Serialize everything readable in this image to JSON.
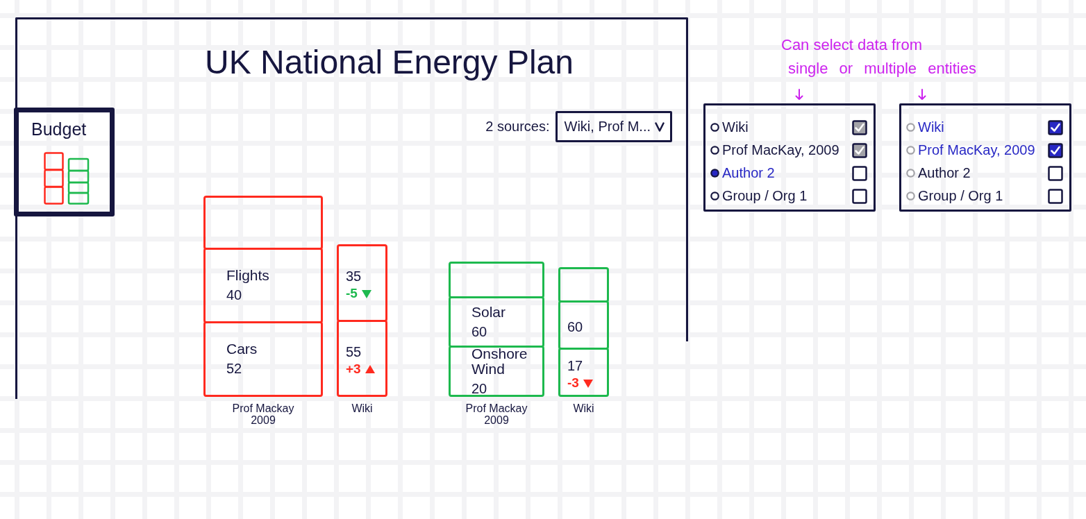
{
  "title": "UK National Energy Plan",
  "budget": {
    "title": "Budget"
  },
  "source_filter": {
    "label": "2 sources:",
    "value": "Wiki, Prof M..."
  },
  "stack_groups": [
    {
      "color": "#ff2a1f",
      "stacks": [
        {
          "caption": "Prof Mackay 2009",
          "segments": [
            {
              "kind": "empty"
            },
            {
              "kind": "item",
              "label": "Flights",
              "value": "40"
            },
            {
              "kind": "item",
              "label": "Cars",
              "value": "52"
            }
          ]
        },
        {
          "caption": "Wiki",
          "segments": [
            {
              "kind": "item",
              "value": "35",
              "change": {
                "text": "-5",
                "rising": false,
                "color": "#1db94e"
              }
            },
            {
              "kind": "item",
              "value": "55",
              "change": {
                "text": "+3",
                "rising": true,
                "color": "#ff2a1f"
              }
            }
          ]
        }
      ]
    },
    {
      "color": "#1db94e",
      "stacks": [
        {
          "caption": "Prof Mackay 2009",
          "segments": [
            {
              "kind": "empty"
            },
            {
              "kind": "item",
              "label": "Solar",
              "value": "60"
            },
            {
              "kind": "item",
              "label": "Onshore Wind",
              "value": "20"
            }
          ]
        },
        {
          "caption": "Wiki",
          "segments": [
            {
              "kind": "empty"
            },
            {
              "kind": "item",
              "value": "60"
            },
            {
              "kind": "item",
              "value": "17",
              "change": {
                "text": "-3",
                "rising": false,
                "color": "#ff2a1f"
              }
            }
          ]
        }
      ]
    }
  ],
  "annotation": {
    "lines": [
      "Can select data from",
      "single or multiple entities"
    ]
  },
  "selection_panels": [
    {
      "kind": "single",
      "items": [
        {
          "label": "Wiki",
          "selected": false,
          "checked": true
        },
        {
          "label": "Prof MacKay, 2009",
          "selected": false,
          "checked": true
        },
        {
          "label": "Author 2",
          "selected": true,
          "checked": false
        },
        {
          "label": "Group / Org 1",
          "selected": false,
          "checked": false
        }
      ]
    },
    {
      "kind": "multiple",
      "items": [
        {
          "label": "Wiki",
          "selected": false,
          "checked": true
        },
        {
          "label": "Prof MacKay, 2009",
          "selected": false,
          "checked": true
        },
        {
          "label": "Author 2",
          "selected": false,
          "checked": false
        },
        {
          "label": "Group / Org 1",
          "selected": false,
          "checked": false
        }
      ]
    }
  ]
}
